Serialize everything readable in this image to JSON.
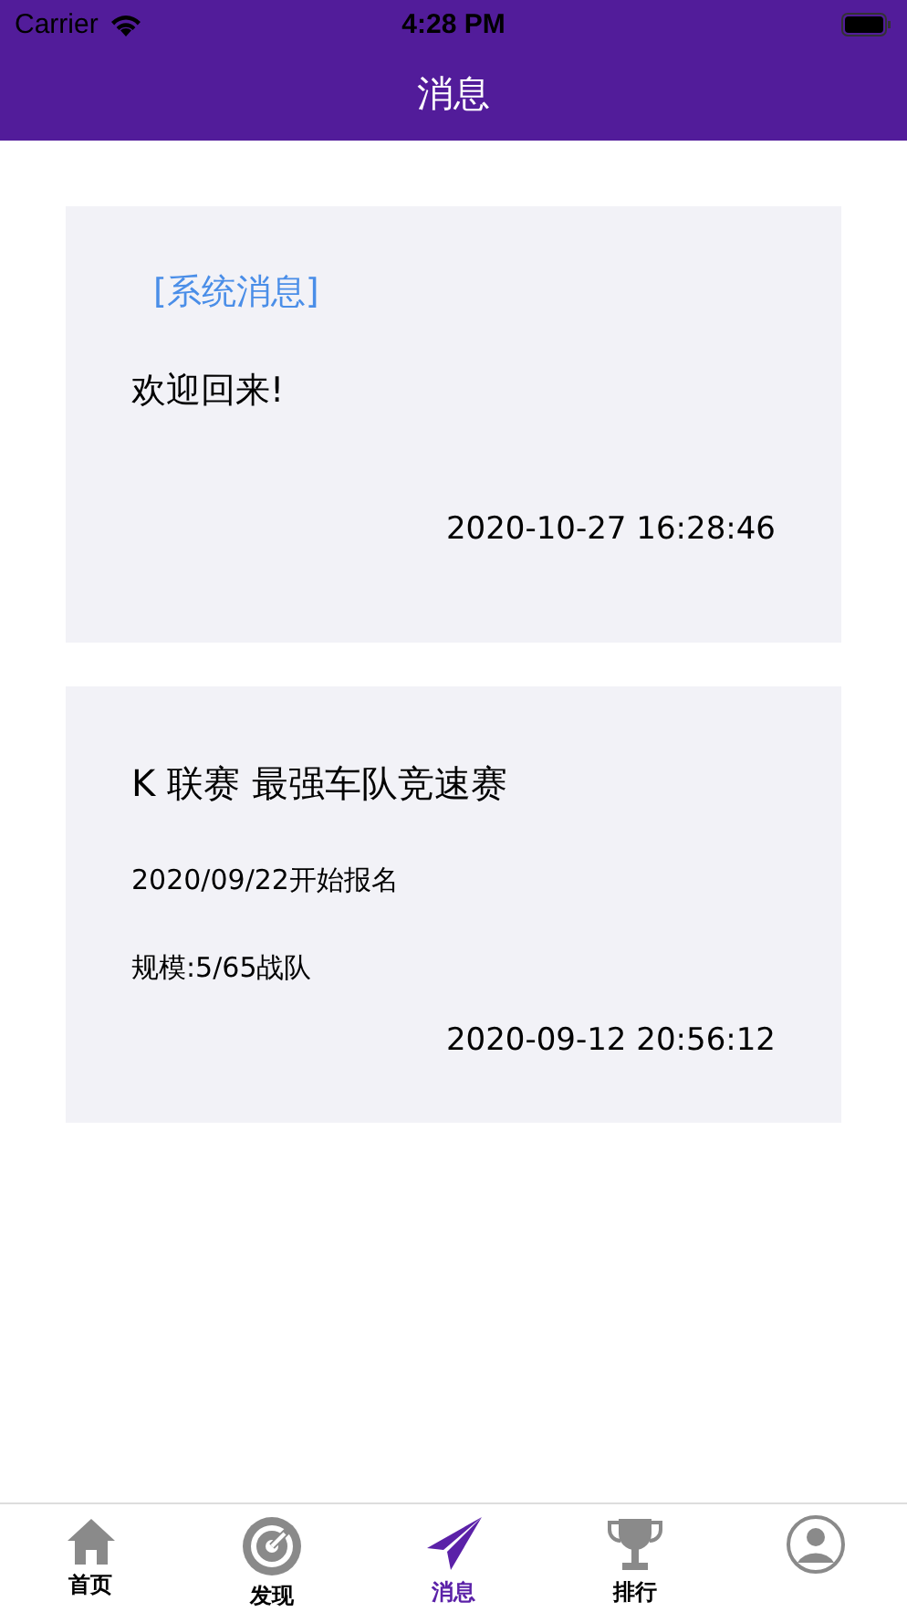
{
  "status_bar": {
    "carrier": "Carrier",
    "time": "4:28 PM"
  },
  "nav": {
    "title": "消息"
  },
  "messages": [
    {
      "lines": [
        {
          "kind": "tag",
          "text": "[系统消息]"
        },
        {
          "kind": "body",
          "text": "欢迎回来!"
        },
        {
          "kind": "time",
          "text": "2020-10-27 16:28:46"
        }
      ]
    },
    {
      "lines": [
        {
          "kind": "title",
          "text": "K 联赛 最强车队竞速赛"
        },
        {
          "kind": "small",
          "text": "2020/09/22开始报名"
        },
        {
          "kind": "small",
          "text": "规模:5/65战队"
        },
        {
          "kind": "time",
          "text": "2020-09-12 20:56:12"
        }
      ]
    }
  ],
  "tabs": [
    {
      "kind": "home",
      "label": "首页",
      "selected": false
    },
    {
      "kind": "discover",
      "label": "发现",
      "selected": false
    },
    {
      "kind": "message",
      "label": "消息",
      "selected": true
    },
    {
      "kind": "rank",
      "label": "排行",
      "selected": false
    },
    {
      "kind": "profile",
      "selected": false
    }
  ]
}
